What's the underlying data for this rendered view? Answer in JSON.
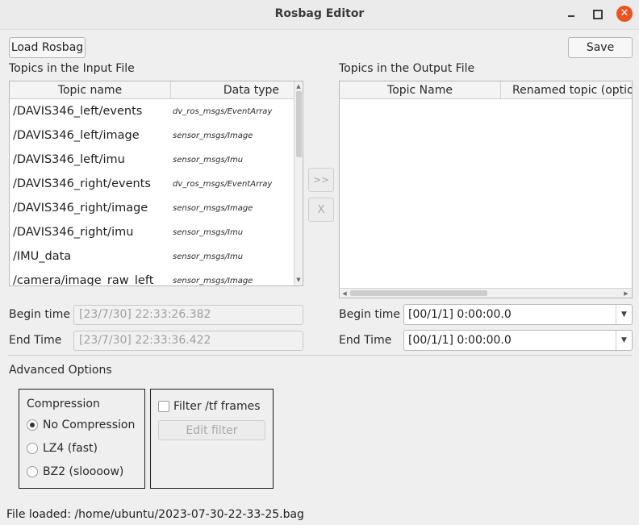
{
  "window": {
    "title": "Rosbag Editor",
    "close_glyph": "✕"
  },
  "toolbar": {
    "load_label": "Load Rosbag",
    "save_label": "Save"
  },
  "input": {
    "heading": "Topics in the Input File",
    "columns": [
      "Topic name",
      "Data type"
    ],
    "rows": [
      {
        "name": "/DAVIS346_left/events",
        "type": "dv_ros_msgs/EventArray"
      },
      {
        "name": "/DAVIS346_left/image",
        "type": "sensor_msgs/Image"
      },
      {
        "name": "/DAVIS346_left/imu",
        "type": "sensor_msgs/Imu"
      },
      {
        "name": "/DAVIS346_right/events",
        "type": "dv_ros_msgs/EventArray"
      },
      {
        "name": "/DAVIS346_right/image",
        "type": "sensor_msgs/Image"
      },
      {
        "name": "/DAVIS346_right/imu",
        "type": "sensor_msgs/Imu"
      },
      {
        "name": "/IMU_data",
        "type": "sensor_msgs/Imu"
      },
      {
        "name": "/camera/image_raw_left",
        "type": "sensor_msgs/Image"
      }
    ],
    "begin_label": "Begin time",
    "begin_value": "[23/7/30] 22:33:26.382",
    "end_label": "End Time",
    "end_value": "[23/7/30] 22:33:36.422"
  },
  "transfer": {
    "add_label": ">>",
    "remove_label": "X"
  },
  "output": {
    "heading": "Topics in the Output File",
    "columns": [
      "Topic Name",
      "Renamed topic (optio"
    ],
    "begin_label": "Begin time",
    "begin_value": "[00/1/1] 0:00:00.0",
    "end_label": "End Time",
    "end_value": "[00/1/1] 0:00:00.0"
  },
  "advanced": {
    "heading": "Advanced Options",
    "compression_title": "Compression",
    "compression_options": [
      "No Compression",
      "LZ4 (fast)",
      "BZ2 (sloooow)"
    ],
    "compression_selected": "No Compression",
    "filter_tf_label": "Filter /tf frames",
    "filter_tf_checked": false,
    "edit_filter_label": "Edit filter"
  },
  "status": {
    "text": "File loaded: /home/ubuntu/2023-07-30-22-33-25.bag"
  },
  "colors": {
    "close_button": "#e95420",
    "window_bg": "#efefef"
  }
}
